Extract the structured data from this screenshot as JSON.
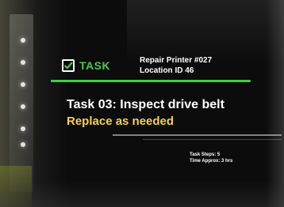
{
  "theme": {
    "accent": "#47c94a",
    "highlight": "#f6d24a"
  },
  "header": {
    "task_icon": "checkbox-check-icon",
    "task_label": "TASK",
    "repair_line": "Repair Printer #027",
    "location_line": "Location ID 46"
  },
  "main": {
    "title": "Task 03: Inspect drive belt",
    "subtitle": "Replace as needed"
  },
  "meta": {
    "steps": "Task Steps: 5",
    "time": "Time Approx: 3 hrs"
  }
}
